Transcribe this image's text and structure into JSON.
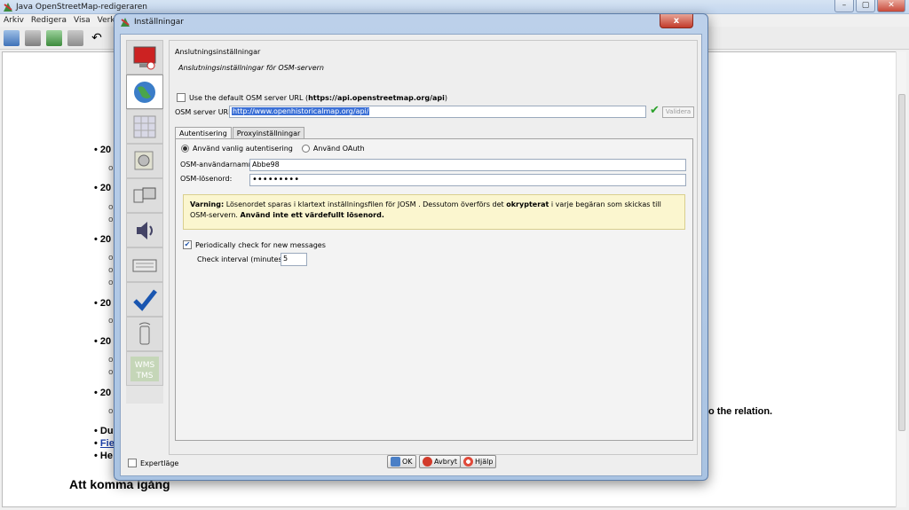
{
  "app": {
    "title": "Java OpenStreetMap-redigeraren",
    "menu": [
      "Arkiv",
      "Redigera",
      "Visa",
      "Verktyg"
    ]
  },
  "background": {
    "bullets": [
      "20",
      "20",
      "20",
      "20",
      "20",
      "20"
    ],
    "sub_marker": "o",
    "relation_text": "o the relation.",
    "du_text": "Du",
    "fie_link": "Fie",
    "he_text": "He",
    "heading": "Att komma igång"
  },
  "dialog": {
    "title": "Inställningar",
    "close_label": "x",
    "section_title": "Anslutningsinställningar",
    "section_subtitle": "Anslutningsinställningar för OSM-servern",
    "default_url_label": "Use the default OSM server URL (",
    "default_url_value": "https://api.openstreetmap.org/api",
    "default_url_close": ")",
    "server_url_label": "OSM server URL:",
    "server_url_value": "http://www.openhistoricalmap.org/api/",
    "validate_label": "Validera",
    "tabs": [
      {
        "label": "Autentisering"
      },
      {
        "label": "Proxyinställningar"
      }
    ],
    "auth": {
      "basic_label": "Använd vanlig autentisering",
      "oauth_label": "Använd OAuth",
      "username_label": "OSM-användarnamn:",
      "username_value": "Abbe98",
      "password_label": "OSM-lösenord:",
      "password_value": "•••••••••"
    },
    "warning": {
      "lead": "Varning:",
      "text1": " Lösenordet sparas i klartext inställningsfilen för JOSM . Dessutom överförs det ",
      "bold1": "okrypterat",
      "text2": " i varje begäran som skickas till OSM-servern. ",
      "bold2": "Använd inte ett värdefullt lösenord."
    },
    "messages": {
      "check_label": "Periodically check for new messages",
      "interval_label": "Check interval (minutes):",
      "interval_value": "5"
    },
    "expert_label": "Expertläge",
    "ok_label": "OK",
    "cancel_label": "Avbryt",
    "help_label": "Hjälp"
  },
  "colors": {
    "accent": "#3a6fd6",
    "warning_bg": "#fbf6cf",
    "valid_green": "#2aa12a"
  }
}
